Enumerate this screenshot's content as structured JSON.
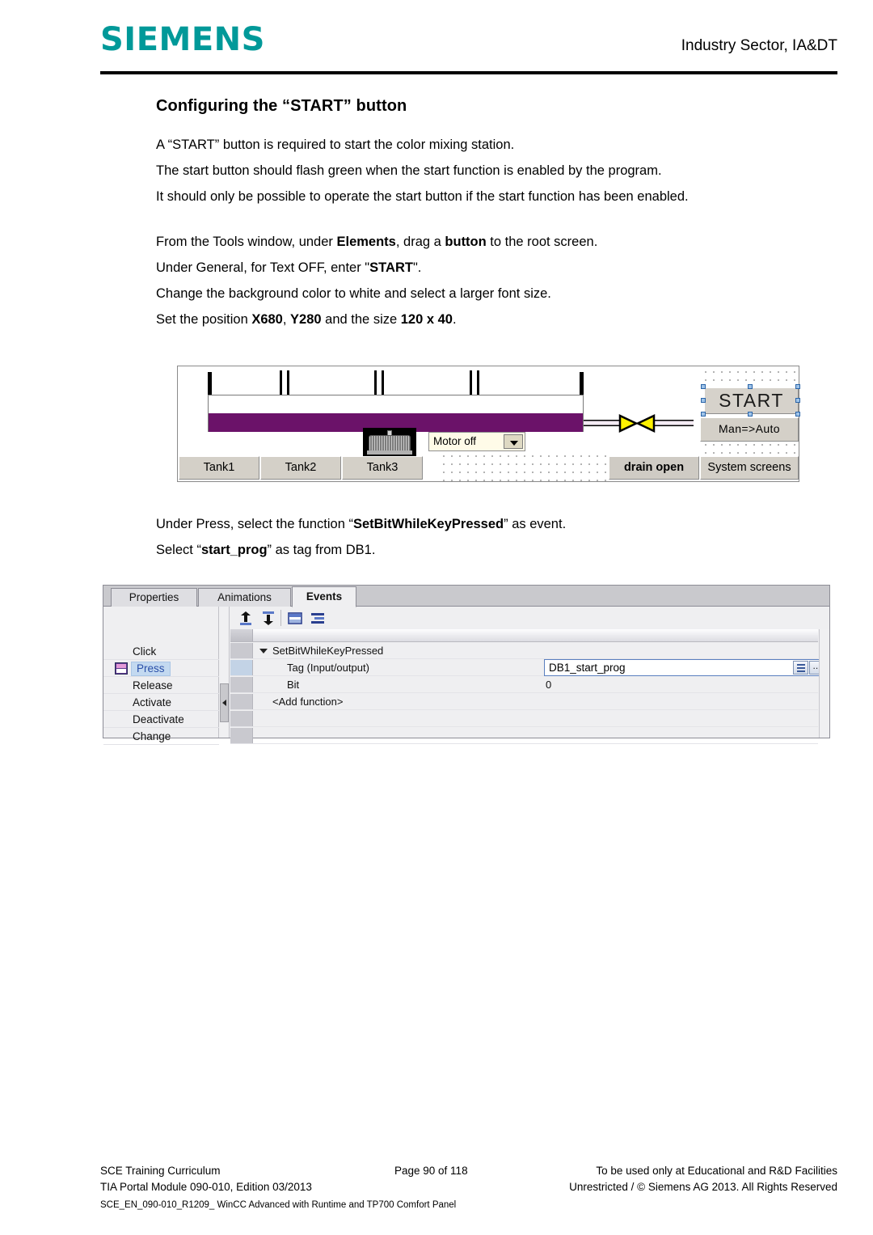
{
  "header": {
    "logo": "SIEMENS",
    "right_text": "Industry Sector, IA&DT"
  },
  "document": {
    "title": "Configuring the “START” button",
    "paragraphs": [
      "A “START” button is required to start the color mixing station.",
      "The start button should flash green when the start function is enabled by the program.",
      "It should only be possible to operate the start button if the start function has been enabled."
    ],
    "instructions": {
      "line1_a": "From the Tools window, under ",
      "line1_b": "Elements",
      "line1_c": ", drag a ",
      "line1_d": "button",
      "line1_e": " to the root screen.",
      "line2_a": "Under General, for Text OFF, enter \"",
      "line2_b": "START",
      "line2_c": "\".",
      "line3": "Change the background color to white and select a larger font size.",
      "line4_a": "Set the position ",
      "line4_b": "X680",
      "line4_c": ", ",
      "line4_d": "Y280",
      "line4_e": " and the size ",
      "line4_f": "120 x 40",
      "line4_g": "."
    },
    "instructions2": {
      "line1_a": "Under Press, select the function “",
      "line1_b": "SetBitWhileKeyPressed",
      "line1_c": "” as event.",
      "line2_a": "Select “",
      "line2_b": "start_prog",
      "line2_c": "” as tag from DB1."
    }
  },
  "hmi": {
    "start_button": "START",
    "man_auto_button": "Man=>Auto",
    "tank_buttons": [
      "Tank1",
      "Tank2",
      "Tank3"
    ],
    "drain_button": "drain open",
    "system_screens_button": "System screens",
    "motor_combo_value": "Motor off",
    "colors": {
      "liquid": "#6B1269",
      "valve": "#FFF200",
      "button_face": "#d4d0c8"
    }
  },
  "events_panel": {
    "tabs": [
      {
        "label": "Properties",
        "active": false
      },
      {
        "label": "Animations",
        "active": false
      },
      {
        "label": "Events",
        "active": true
      }
    ],
    "event_list": [
      {
        "label": "Click",
        "selected": false
      },
      {
        "label": "Press",
        "selected": true
      },
      {
        "label": "Release",
        "selected": false
      },
      {
        "label": "Activate",
        "selected": false
      },
      {
        "label": "Deactivate",
        "selected": false
      },
      {
        "label": "Change",
        "selected": false
      }
    ],
    "toolbar_icons": [
      "move-to-top-icon",
      "move-to-bottom-icon",
      "folder-icon",
      "list-icon"
    ],
    "rows": [
      {
        "name": "SetBitWhileKeyPressed",
        "value": ""
      },
      {
        "name": "Tag (Input/output)",
        "value": "DB1_start_prog"
      },
      {
        "name": "Bit",
        "value": "0"
      },
      {
        "name": "<Add function>",
        "value": ""
      }
    ],
    "tag_field_value": "DB1_start_prog",
    "tag_browse_label": "..."
  },
  "footer": {
    "left_line1": "SCE Training Curriculum",
    "left_line2": "TIA Portal Module 090-010, Edition 03/2013",
    "center_line1": "Page 90 of 118",
    "right_line1": "To be used only at Educational and R&D Facilities",
    "right_line2": "Unrestricted / © Siemens AG 2013. All Rights Reserved",
    "doc_id": "SCE_EN_090-010_R1209_ WinCC Advanced with Runtime and TP700 Comfort Panel"
  }
}
